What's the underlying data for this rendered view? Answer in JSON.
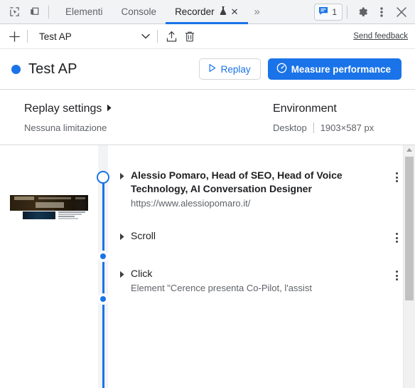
{
  "tabbar": {
    "inspect_icon": "inspect-cursor-icon",
    "device_icon": "device-toolbar-icon",
    "tabs": [
      {
        "label": "Elementi",
        "active": false
      },
      {
        "label": "Console",
        "active": false
      },
      {
        "label": "Recorder",
        "active": true
      }
    ],
    "recorder_experimental_icon": "flask-icon",
    "recorder_close_label": "✕",
    "more_tabs_label": "»",
    "issues_icon": "issues-message-icon",
    "issues_count": "1",
    "settings_icon": "gear-icon",
    "more_options_icon": "kebab-menu-icon",
    "close_icon": "close-icon",
    "active_underline_color": "#1a73e8"
  },
  "toolbar": {
    "add_label": "+",
    "recording_name": "Test AP",
    "chevron_icon": "chevron-down-icon",
    "export_icon": "export-upload-icon",
    "delete_icon": "trash-icon",
    "feedback_label": "Send feedback"
  },
  "header": {
    "status_dot_color": "#1a73e8",
    "title": "Test AP",
    "replay_label": "Replay",
    "replay_icon": "play-triangle-icon",
    "measure_label": "Measure performance",
    "measure_icon": "speedometer-icon",
    "primary_color": "#1a73e8"
  },
  "settings": {
    "replay_heading": "Replay settings",
    "replay_expand_icon": "triangle-right-icon",
    "replay_value": "Nessuna limitazione",
    "environment_heading": "Environment",
    "environment_device": "Desktop",
    "environment_viewport": "1903×587 px"
  },
  "steps": [
    {
      "title": "Alessio Pomaro, Head of SEO, Head of Voice Technology, AI Conversation Designer",
      "subtitle": "https://www.alessiopomaro.it/",
      "bold": true,
      "node": "ring",
      "has_thumbnail": true,
      "expand_icon": "triangle-right-icon",
      "menu_icon": "kebab-menu-icon"
    },
    {
      "title": "Scroll",
      "subtitle": "",
      "bold": false,
      "node": "dot",
      "has_thumbnail": false,
      "expand_icon": "triangle-right-icon",
      "menu_icon": "kebab-menu-icon"
    },
    {
      "title": "Click",
      "subtitle": "Element \"Cerence presenta Co-Pilot, l'assist",
      "bold": false,
      "node": "dot",
      "has_thumbnail": false,
      "expand_icon": "triangle-right-icon",
      "menu_icon": "kebab-menu-icon"
    }
  ],
  "scrollbar": {
    "up_arrow_icon": "scroll-up-arrow-icon",
    "thumb_name": "scrollbar-thumb"
  }
}
